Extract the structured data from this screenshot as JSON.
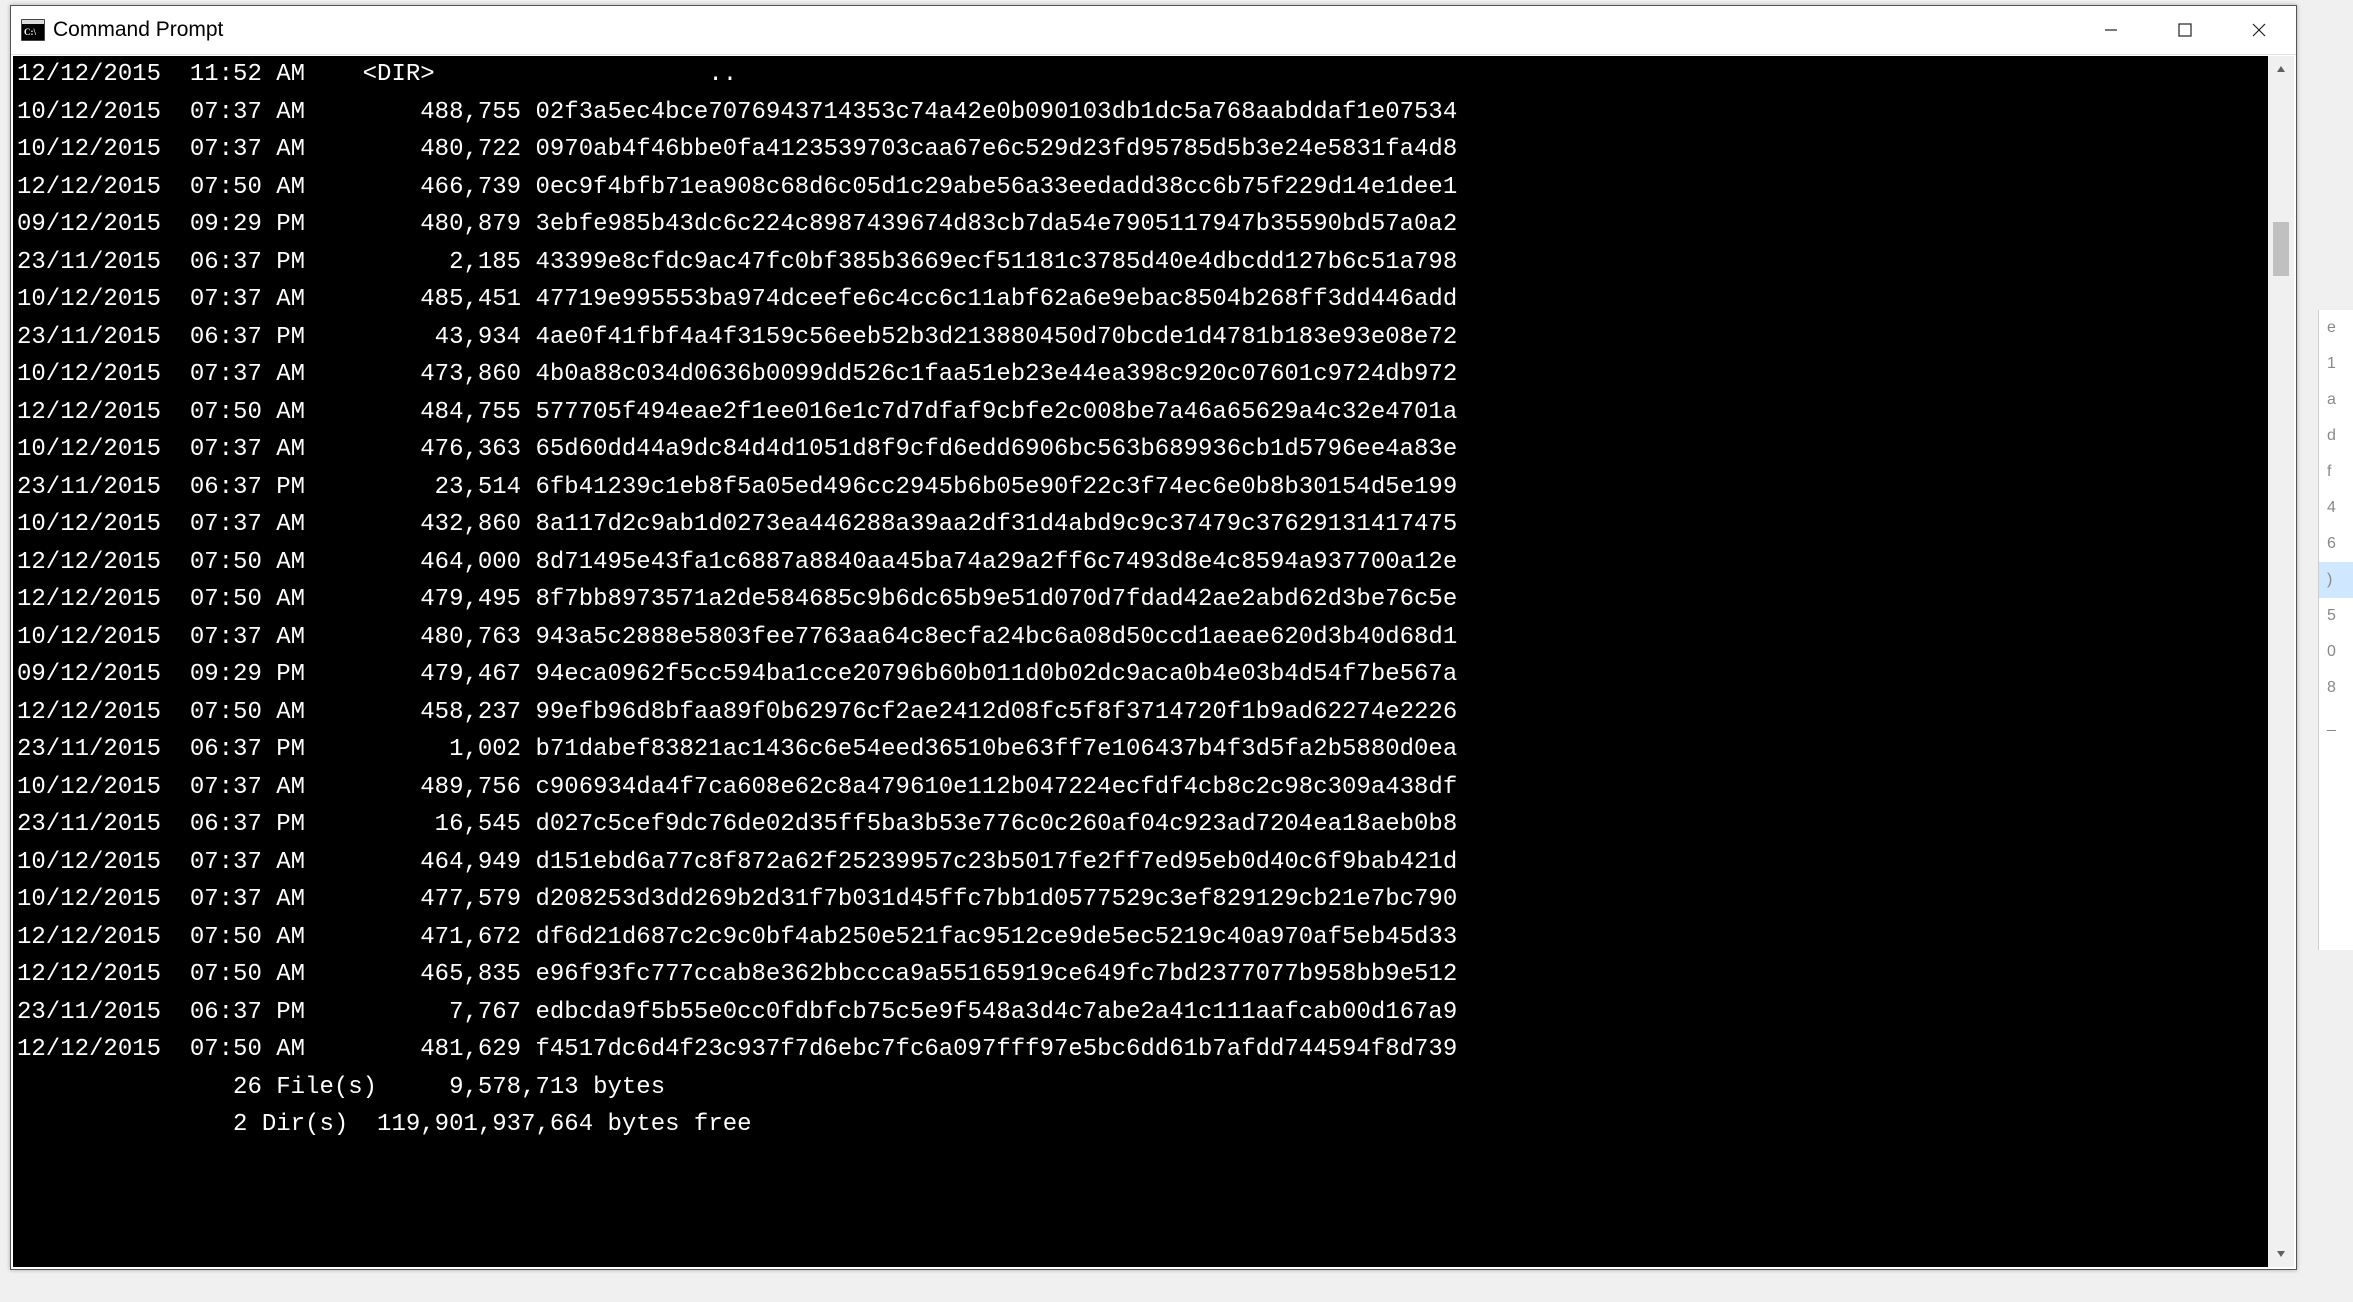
{
  "window": {
    "title": "Command Prompt",
    "icon_name": "cmd-icon"
  },
  "dir_listing": [
    {
      "date": "12/12/2015",
      "time": "11:52 AM",
      "type": "<DIR>",
      "size": "",
      "name": ".."
    },
    {
      "date": "10/12/2015",
      "time": "07:37 AM",
      "type": "",
      "size": "488,755",
      "name": "02f3a5ec4bce7076943714353c74a42e0b090103db1dc5a768aabddaf1e07534"
    },
    {
      "date": "10/12/2015",
      "time": "07:37 AM",
      "type": "",
      "size": "480,722",
      "name": "0970ab4f46bbe0fa4123539703caa67e6c529d23fd95785d5b3e24e5831fa4d8"
    },
    {
      "date": "12/12/2015",
      "time": "07:50 AM",
      "type": "",
      "size": "466,739",
      "name": "0ec9f4bfb71ea908c68d6c05d1c29abe56a33eedadd38cc6b75f229d14e1dee1"
    },
    {
      "date": "09/12/2015",
      "time": "09:29 PM",
      "type": "",
      "size": "480,879",
      "name": "3ebfe985b43dc6c224c8987439674d83cb7da54e7905117947b35590bd57a0a2"
    },
    {
      "date": "23/11/2015",
      "time": "06:37 PM",
      "type": "",
      "size": "2,185",
      "name": "43399e8cfdc9ac47fc0bf385b3669ecf51181c3785d40e4dbcdd127b6c51a798"
    },
    {
      "date": "10/12/2015",
      "time": "07:37 AM",
      "type": "",
      "size": "485,451",
      "name": "47719e995553ba974dceefe6c4cc6c11abf62a6e9ebac8504b268ff3dd446add"
    },
    {
      "date": "23/11/2015",
      "time": "06:37 PM",
      "type": "",
      "size": "43,934",
      "name": "4ae0f41fbf4a4f3159c56eeb52b3d213880450d70bcde1d4781b183e93e08e72"
    },
    {
      "date": "10/12/2015",
      "time": "07:37 AM",
      "type": "",
      "size": "473,860",
      "name": "4b0a88c034d0636b0099dd526c1faa51eb23e44ea398c920c07601c9724db972"
    },
    {
      "date": "12/12/2015",
      "time": "07:50 AM",
      "type": "",
      "size": "484,755",
      "name": "577705f494eae2f1ee016e1c7d7dfaf9cbfe2c008be7a46a65629a4c32e4701a"
    },
    {
      "date": "10/12/2015",
      "time": "07:37 AM",
      "type": "",
      "size": "476,363",
      "name": "65d60dd44a9dc84d4d1051d8f9cfd6edd6906bc563b689936cb1d5796ee4a83e"
    },
    {
      "date": "23/11/2015",
      "time": "06:37 PM",
      "type": "",
      "size": "23,514",
      "name": "6fb41239c1eb8f5a05ed496cc2945b6b05e90f22c3f74ec6e0b8b30154d5e199"
    },
    {
      "date": "10/12/2015",
      "time": "07:37 AM",
      "type": "",
      "size": "432,860",
      "name": "8a117d2c9ab1d0273ea446288a39aa2df31d4abd9c9c37479c37629131417475"
    },
    {
      "date": "12/12/2015",
      "time": "07:50 AM",
      "type": "",
      "size": "464,000",
      "name": "8d71495e43fa1c6887a8840aa45ba74a29a2ff6c7493d8e4c8594a937700a12e"
    },
    {
      "date": "12/12/2015",
      "time": "07:50 AM",
      "type": "",
      "size": "479,495",
      "name": "8f7bb8973571a2de584685c9b6dc65b9e51d070d7fdad42ae2abd62d3be76c5e"
    },
    {
      "date": "10/12/2015",
      "time": "07:37 AM",
      "type": "",
      "size": "480,763",
      "name": "943a5c2888e5803fee7763aa64c8ecfa24bc6a08d50ccd1aeae620d3b40d68d1"
    },
    {
      "date": "09/12/2015",
      "time": "09:29 PM",
      "type": "",
      "size": "479,467",
      "name": "94eca0962f5cc594ba1cce20796b60b011d0b02dc9aca0b4e03b4d54f7be567a"
    },
    {
      "date": "12/12/2015",
      "time": "07:50 AM",
      "type": "",
      "size": "458,237",
      "name": "99efb96d8bfaa89f0b62976cf2ae2412d08fc5f8f3714720f1b9ad62274e2226"
    },
    {
      "date": "23/11/2015",
      "time": "06:37 PM",
      "type": "",
      "size": "1,002",
      "name": "b71dabef83821ac1436c6e54eed36510be63ff7e106437b4f3d5fa2b5880d0ea"
    },
    {
      "date": "10/12/2015",
      "time": "07:37 AM",
      "type": "",
      "size": "489,756",
      "name": "c906934da4f7ca608e62c8a479610e112b047224ecfdf4cb8c2c98c309a438df"
    },
    {
      "date": "23/11/2015",
      "time": "06:37 PM",
      "type": "",
      "size": "16,545",
      "name": "d027c5cef9dc76de02d35ff5ba3b53e776c0c260af04c923ad7204ea18aeb0b8"
    },
    {
      "date": "10/12/2015",
      "time": "07:37 AM",
      "type": "",
      "size": "464,949",
      "name": "d151ebd6a77c8f872a62f25239957c23b5017fe2ff7ed95eb0d40c6f9bab421d"
    },
    {
      "date": "10/12/2015",
      "time": "07:37 AM",
      "type": "",
      "size": "477,579",
      "name": "d208253d3dd269b2d31f7b031d45ffc7bb1d0577529c3ef829129cb21e7bc790"
    },
    {
      "date": "12/12/2015",
      "time": "07:50 AM",
      "type": "",
      "size": "471,672",
      "name": "df6d21d687c2c9c0bf4ab250e521fac9512ce9de5ec5219c40a970af5eb45d33"
    },
    {
      "date": "12/12/2015",
      "time": "07:50 AM",
      "type": "",
      "size": "465,835",
      "name": "e96f93fc777ccab8e362bbccca9a55165919ce649fc7bd2377077b958bb9e512"
    },
    {
      "date": "23/11/2015",
      "time": "06:37 PM",
      "type": "",
      "size": "7,767",
      "name": "edbcda9f5b55e0cc0fdbfcb75c5e9f548a3d4c7abe2a41c111aafcab00d167a9"
    },
    {
      "date": "12/12/2015",
      "time": "07:50 AM",
      "type": "",
      "size": "481,629",
      "name": "f4517dc6d4f23c937f7d6ebc7fc6a097fff97e5bc6dd61b7afdd744594f8d739"
    }
  ],
  "summary": {
    "file_count": "26",
    "file_label": "File(s)",
    "total_bytes": "9,578,713",
    "bytes_label": "bytes",
    "dir_count": "2",
    "dir_label": "Dir(s)",
    "free_bytes": "119,901,937,664",
    "free_label": "bytes free"
  },
  "ghost_labels": [
    "e",
    "1",
    "a",
    "d",
    "f",
    "4",
    "6",
    ")",
    "5",
    "0",
    "8",
    "_"
  ]
}
